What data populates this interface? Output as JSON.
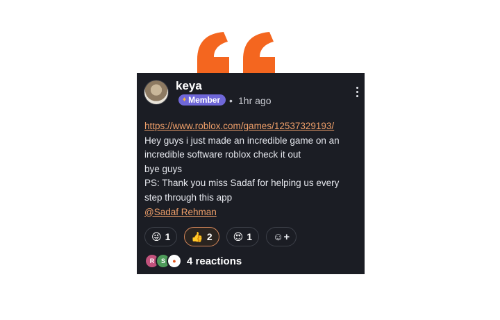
{
  "post": {
    "username": "keya",
    "badge": "Member",
    "badge_icon": "gem-icon",
    "separator": "•",
    "time": "1hr ago",
    "link": "https://www.roblox.com/games/12537329193/",
    "lines": [
      "Hey guys i just made an incredible game on an",
      "incredible software roblox check it out",
      "bye guys",
      "PS: Thank you miss Sadaf for helping us every",
      "step through this app"
    ],
    "mention": "@Sadaf Rehman"
  },
  "reactions": [
    {
      "emoji": "😜",
      "count": "1",
      "active": false
    },
    {
      "emoji": "👍",
      "count": "2",
      "active": true
    },
    {
      "emoji": "😍",
      "count": "1",
      "active": false
    }
  ],
  "add_reaction": "☺+",
  "summary": {
    "avatars": [
      "R",
      "S",
      "●"
    ],
    "label": "4 reactions"
  },
  "colors": {
    "card_bg": "#1b1d24",
    "accent": "#f0a06a",
    "badge": "#6f67d8",
    "quote": "#f4661f"
  }
}
